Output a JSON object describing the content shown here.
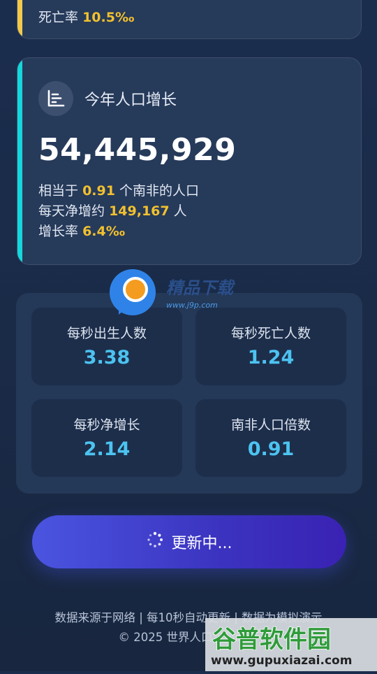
{
  "death_card": {
    "rate_label": "死亡率",
    "rate_value": "10.5‰"
  },
  "growth_card": {
    "title": "今年人口增长",
    "total": "54,445,929",
    "equiv_prefix": "相当于",
    "equiv_value": "0.91",
    "equiv_suffix": "个南非的人口",
    "daily_prefix": "每天净增约",
    "daily_value": "149,167",
    "daily_suffix": "人",
    "rate_label": "增长率",
    "rate_value": "6.4‰",
    "accent_color": "#14d8dc",
    "icon": "chart-icon"
  },
  "stats": [
    {
      "label": "每秒出生人数",
      "value": "3.38"
    },
    {
      "label": "每秒死亡人数",
      "value": "1.24"
    },
    {
      "label": "每秒净增长",
      "value": "2.14"
    },
    {
      "label": "南非人口倍数",
      "value": "0.91"
    }
  ],
  "update_button": {
    "label": "更新中...",
    "icon": "spinner-icon"
  },
  "footer": {
    "line1": "数据来源于网络 | 每10秒自动更新 | 数据为模拟演示",
    "line2": "© 2025 世界人口实时统计"
  },
  "watermarks": {
    "top_text": "精品下载",
    "top_url": "www.j9p.com",
    "bottom_text": "谷普软件园",
    "bottom_url": "www.gupuxiazai.com"
  },
  "colors": {
    "highlight": "#f2c12e",
    "stat_value": "#4cc3f0",
    "death_accent": "#f2c94c"
  }
}
